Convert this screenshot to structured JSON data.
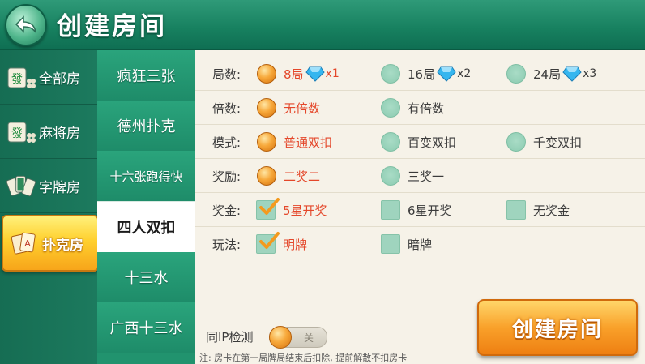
{
  "header": {
    "title": "创建房间"
  },
  "categories": [
    {
      "label": "全部房",
      "icon": "fa-tile-icon"
    },
    {
      "label": "麻将房",
      "icon": "fa-tile-icon"
    },
    {
      "label": "字牌房",
      "icon": "zipai-cards-icon"
    },
    {
      "label": "扑克房",
      "icon": "poker-cards-icon",
      "active": true
    }
  ],
  "subgames": [
    {
      "label": "疯狂三张"
    },
    {
      "label": "德州扑克"
    },
    {
      "label": "十六张跑得快"
    },
    {
      "label": "四人双扣",
      "active": true
    },
    {
      "label": "十三水"
    },
    {
      "label": "广西十三水"
    }
  ],
  "options": {
    "rounds": {
      "label": "局数:",
      "choices": [
        {
          "text": "8局",
          "mult": "x1",
          "selected": true
        },
        {
          "text": "16局",
          "mult": "x2",
          "selected": false
        },
        {
          "text": "24局",
          "mult": "x3",
          "selected": false
        }
      ]
    },
    "multiplier": {
      "label": "倍数:",
      "choices": [
        {
          "text": "无倍数",
          "selected": true
        },
        {
          "text": "有倍数",
          "selected": false
        }
      ]
    },
    "mode": {
      "label": "模式:",
      "choices": [
        {
          "text": "普通双扣",
          "selected": true
        },
        {
          "text": "百变双扣",
          "selected": false
        },
        {
          "text": "千变双扣",
          "selected": false
        }
      ]
    },
    "reward": {
      "label": "奖励:",
      "choices": [
        {
          "text": "二奖二",
          "selected": true
        },
        {
          "text": "三奖一",
          "selected": false
        }
      ]
    },
    "prize": {
      "label": "奖金:",
      "choices": [
        {
          "text": "5星开奖",
          "checked": true
        },
        {
          "text": "6星开奖",
          "checked": false
        },
        {
          "text": "无奖金",
          "checked": false
        }
      ]
    },
    "play": {
      "label": "玩法:",
      "choices": [
        {
          "text": "明牌",
          "checked": true
        },
        {
          "text": "暗牌",
          "checked": false
        }
      ]
    }
  },
  "ip_check": {
    "label": "同IP检测",
    "state": "关"
  },
  "note": "注: 房卡在第一局牌局结束后扣除, 提前解散不扣房卡",
  "create_button": {
    "label": "创建房间"
  },
  "colors": {
    "selected_text": "#e4472a",
    "header": "#17805f",
    "button": "#f9a12a"
  }
}
